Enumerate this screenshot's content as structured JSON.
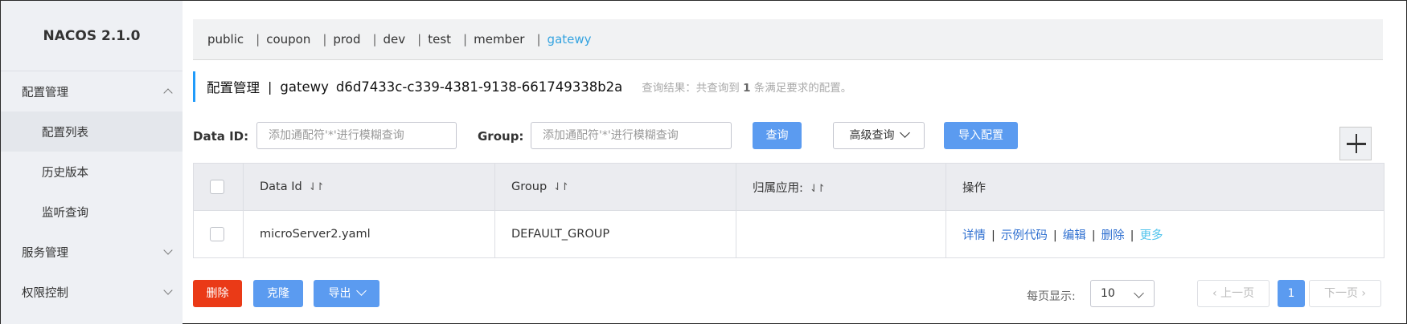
{
  "sidebar": {
    "logo": "NACOS 2.1.0",
    "config_mgmt": "配置管理",
    "config_list": "配置列表",
    "history": "历史版本",
    "listener": "监听查询",
    "service_mgmt": "服务管理",
    "auth_ctrl": "权限控制"
  },
  "namespaces": [
    "public",
    "coupon",
    "prod",
    "dev",
    "test",
    "member",
    "gatewy"
  ],
  "active_namespace": "gatewy",
  "header": {
    "title": "配置管理",
    "separator": "|",
    "namespace": "gatewy",
    "namespace_id": "d6d7433c-c339-4381-9138-661749338b2a",
    "result_prefix": "查询结果：共查询到",
    "result_count": "1",
    "result_suffix": "条满足要求的配置。"
  },
  "search": {
    "data_id_label": "Data ID:",
    "data_id_placeholder": "添加通配符'*'进行模糊查询",
    "group_label": "Group:",
    "group_placeholder": "添加通配符'*'进行模糊查询",
    "query_button": "查询",
    "advanced_button": "高级查询",
    "import_button": "导入配置"
  },
  "table": {
    "headers": [
      "Data Id",
      "Group",
      "归属应用:",
      "操作"
    ],
    "sort_glyph": "⇃↾",
    "rows": [
      {
        "data_id": "microServer2.yaml",
        "group": "DEFAULT_GROUP",
        "app": "",
        "ops": [
          "详情",
          "示例代码",
          "编辑",
          "删除",
          "更多"
        ]
      }
    ]
  },
  "footer": {
    "delete_button": "删除",
    "clone_button": "克隆",
    "export_button": "导出",
    "page_size_label": "每页显示:",
    "page_size": "10",
    "prev": "上一页",
    "next": "下一页",
    "current_page": "1"
  },
  "colors": {
    "primary": "#5b9bf0",
    "danger": "#ea3a17",
    "active_ns": "#34a3e0",
    "link": "#2e6fd0"
  }
}
